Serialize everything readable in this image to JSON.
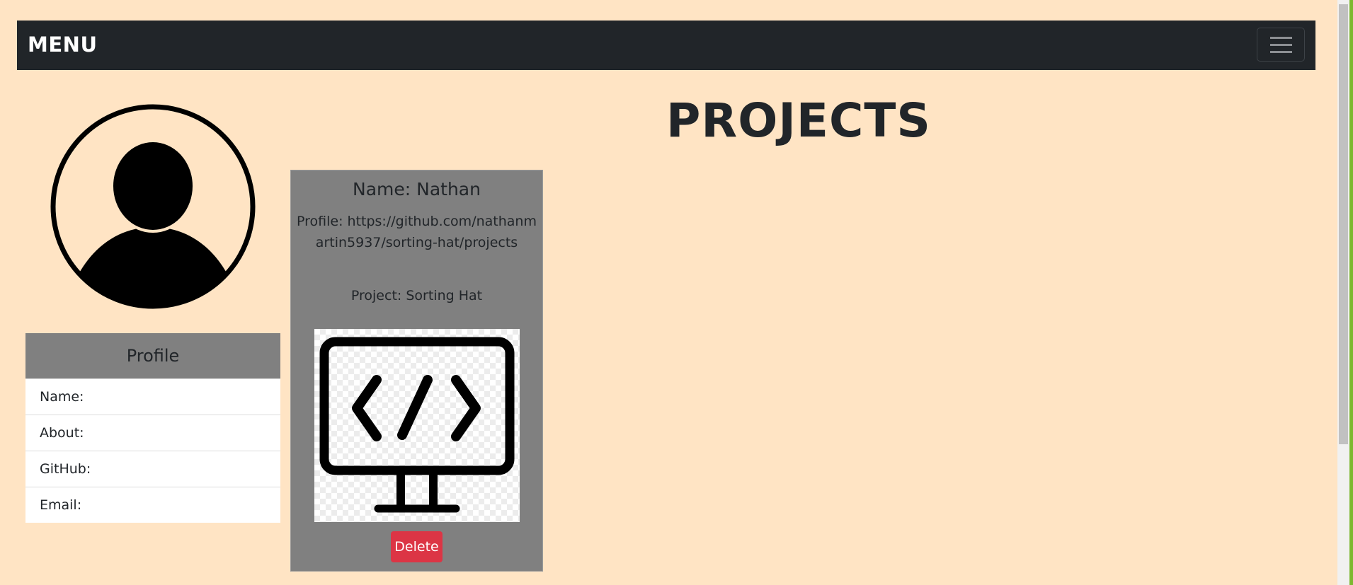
{
  "navbar": {
    "brand": "MENU",
    "toggler_icon": "hamburger-icon"
  },
  "avatar": {
    "icon": "user-avatar-icon"
  },
  "profile": {
    "title": "Profile",
    "items": [
      {
        "label": "Name:"
      },
      {
        "label": "About:"
      },
      {
        "label": "GitHub:"
      },
      {
        "label": "Email:"
      }
    ]
  },
  "main": {
    "heading": "PROJECTS"
  },
  "project_card": {
    "name": "Name: Nathan",
    "profile": "Profile: https://github.com/nathanmartin5937/sorting-hat/projects",
    "project": "Project: Sorting Hat",
    "image_icon": "code-monitor-icon",
    "delete_label": "Delete"
  },
  "colors": {
    "background": "#ffe4c4",
    "navbar": "#212529",
    "card": "#808080",
    "delete": "#dc3545"
  }
}
